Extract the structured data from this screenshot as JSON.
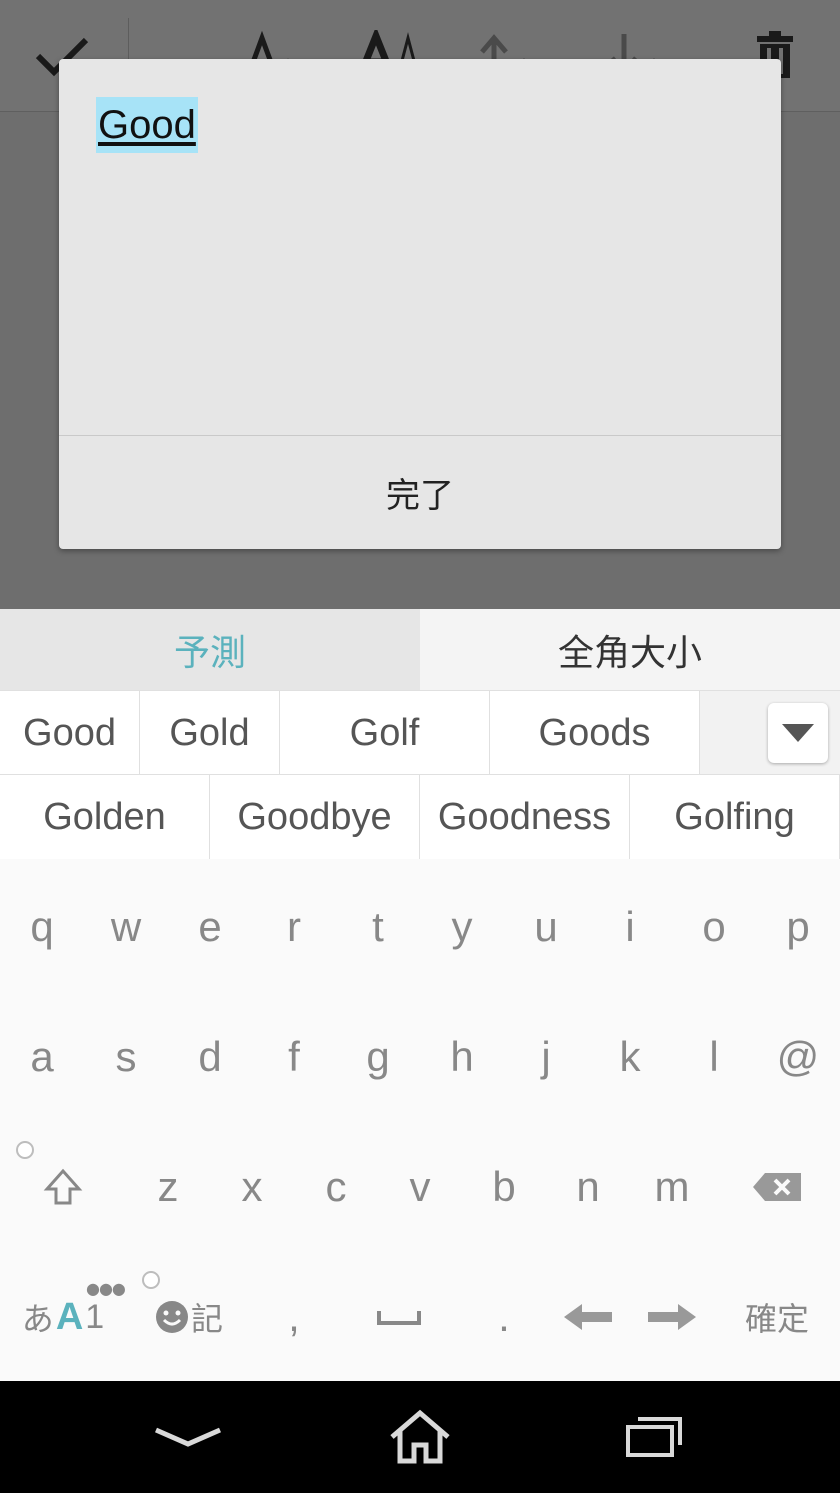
{
  "dialog": {
    "edit_text": "Good",
    "done_label": "完了"
  },
  "keyboard": {
    "tabs": [
      "予測",
      "全角大小"
    ],
    "candidates_row1": [
      "Good",
      "Gold",
      "Golf",
      "Goods"
    ],
    "candidates_row2": [
      "Golden",
      "Goodbye",
      "Goodness",
      "Golfing"
    ],
    "row_qwerty": [
      "q",
      "w",
      "e",
      "r",
      "t",
      "y",
      "u",
      "i",
      "o",
      "p"
    ],
    "row_asdf": [
      "a",
      "s",
      "d",
      "f",
      "g",
      "h",
      "j",
      "k",
      "l",
      "@"
    ],
    "row_zxcv": [
      "z",
      "x",
      "c",
      "v",
      "b",
      "n",
      "m"
    ],
    "mode_switch": {
      "hiragana": "あ",
      "alpha": "A",
      "num": "1"
    },
    "emoji_kigou_label": "記",
    "comma": ",",
    "period": ".",
    "confirm_label": "確定",
    "accent_color": "#5bb2bd"
  },
  "icons": {
    "toolbar": [
      "check-icon",
      "text-size-decrease-icon",
      "text-size-increase-icon",
      "move-up-icon",
      "move-down-icon",
      "delete-icon"
    ],
    "nav": [
      "back-chevron-icon",
      "home-icon",
      "recent-apps-icon"
    ]
  }
}
